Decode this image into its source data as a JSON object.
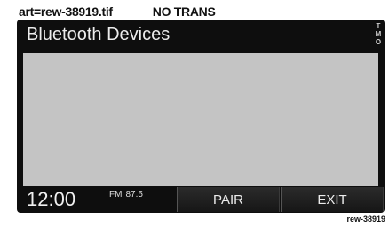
{
  "caption": {
    "art_ref": "art=rew-38919.tif",
    "note": "NO TRANS"
  },
  "screen": {
    "title": "Bluetooth Devices",
    "side_label": "TMO",
    "clock": "12:00",
    "radio": {
      "band": "FM",
      "frequency": "87.5"
    },
    "buttons": {
      "pair": "PAIR",
      "exit": "EXIT"
    }
  },
  "image_ref": "rew-38919"
}
